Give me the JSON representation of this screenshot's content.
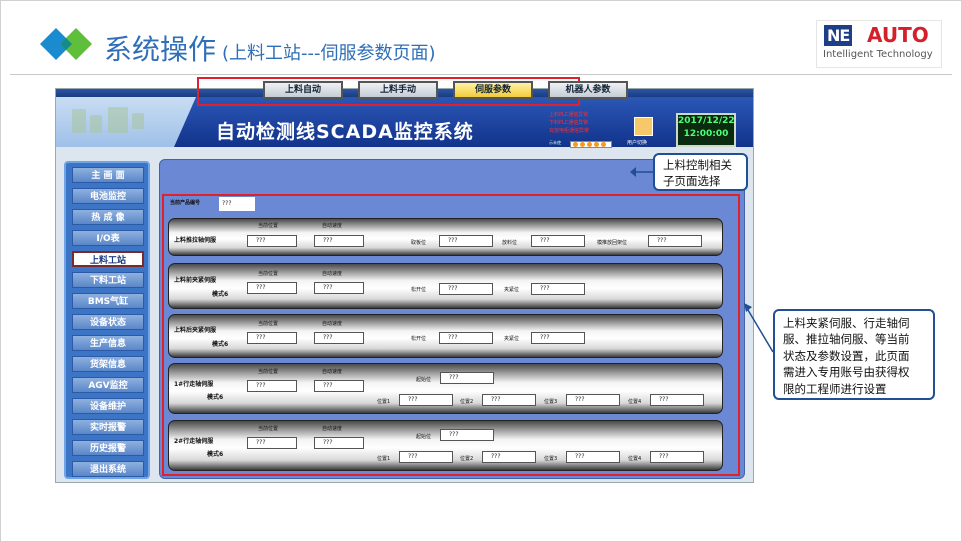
{
  "slide": {
    "title": "系统操作",
    "subtitle": "(上料工站---伺服参数页面)"
  },
  "brand": {
    "ne": "NE",
    "auto": "AUTO",
    "tagline": "Intelligent Technology",
    "colors": {
      "navy": "#1d3f88",
      "red": "#d3202b"
    }
  },
  "scada": {
    "title": "自动检测线SCADA监控系统",
    "alarms": [
      "上料PLC通信异常",
      "下料PLC通信异常",
      "充放电柜通信异常"
    ],
    "alarm_status_label": "示未使",
    "user_switch": "用户切换",
    "clock": {
      "date": "2017/12/22",
      "time": "12:00:00"
    },
    "nav": [
      "主 画 面",
      "电池监控",
      "热 成 像",
      "I/O表",
      "上料工站",
      "下料工站",
      "BMS气缸",
      "设备状态",
      "生产信息",
      "货架信息",
      "AGV监控",
      "设备维护",
      "实时报警",
      "历史报警",
      "退出系统"
    ],
    "nav_active": "上料工站",
    "tabs": [
      "上料自动",
      "上料手动",
      "伺服参数",
      "机器人参数"
    ],
    "tab_active": "伺服参数",
    "product_label": "当前产品编号",
    "product_value": "???",
    "panels": [
      {
        "title": "上料推拉轴伺服",
        "cur_pos_label": "当前位置",
        "auto_speed_label": "自动速度",
        "cur_pos": "???",
        "auto_speed": "???",
        "extra": [
          {
            "label": "取板位",
            "value": "???"
          },
          {
            "label": "放料位",
            "value": "???"
          },
          {
            "label": "模推放回架位",
            "value": "???"
          }
        ]
      },
      {
        "title": "上料前夹紧伺服",
        "mode": "模式6",
        "cur_pos_label": "当前位置",
        "auto_speed_label": "自动速度",
        "cur_pos": "???",
        "auto_speed": "???",
        "extra": [
          {
            "label": "松开位",
            "value": "???"
          },
          {
            "label": "夹紧位",
            "value": "???"
          }
        ]
      },
      {
        "title": "上料后夹紧伺服",
        "mode": "模式6",
        "cur_pos_label": "当前位置",
        "auto_speed_label": "自动速度",
        "cur_pos": "???",
        "auto_speed": "???",
        "extra": [
          {
            "label": "松开位",
            "value": "???"
          },
          {
            "label": "夹紧位",
            "value": "???"
          }
        ]
      },
      {
        "title": "1#行走轴伺服",
        "mode": "模式6",
        "cur_pos_label": "当前位置",
        "auto_speed_label": "自动速度",
        "cur_pos": "???",
        "auto_speed": "???",
        "origin_label": "起始位",
        "origin": "???",
        "positions": [
          {
            "label": "位置1",
            "value": "???"
          },
          {
            "label": "位置2",
            "value": "???"
          },
          {
            "label": "位置3",
            "value": "???"
          },
          {
            "label": "位置4",
            "value": "???"
          }
        ]
      },
      {
        "title": "2#行走轴伺服",
        "mode": "模式6",
        "cur_pos_label": "当前位置",
        "auto_speed_label": "自动速度",
        "cur_pos": "???",
        "auto_speed": "???",
        "origin_label": "起始位",
        "origin": "???",
        "positions": [
          {
            "label": "位置1",
            "value": "???"
          },
          {
            "label": "位置2",
            "value": "???"
          },
          {
            "label": "位置3",
            "value": "???"
          },
          {
            "label": "位置4",
            "value": "???"
          }
        ]
      }
    ]
  },
  "callouts": {
    "tabs_note": [
      "上料控制相关",
      "子页面选择"
    ],
    "params_note": [
      "上料夹紧伺服、行走轴伺",
      "服、推拉轴伺服、等当前",
      "状态及参数设置，此页面",
      "需进入专用账号由获得权",
      "限的工程师进行设置"
    ]
  },
  "colors": {
    "title_blue": "#2f6fb8",
    "highlight_red": "#e0202a",
    "callout_border": "#1f4f94",
    "active_tab": "#f2cb3a"
  }
}
